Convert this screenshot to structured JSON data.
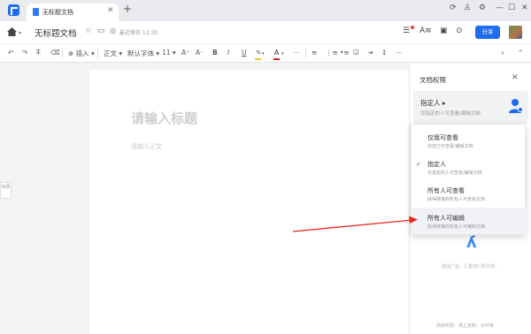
{
  "tab": {
    "title": "无标题文档"
  },
  "header": {
    "doc_title": "无标题文档",
    "save_status": "最近保存 12:30",
    "share_label": "分享"
  },
  "toolbar": {
    "insert_label": "插入",
    "style_label": "正文",
    "font_label": "默认字体",
    "font_size": "11",
    "bold": "B",
    "italic": "I",
    "underline": "U",
    "strike": "S",
    "highlight_color": "#f5c518",
    "font_color": "#e02020"
  },
  "editor": {
    "title_placeholder": "请输入标题",
    "body_placeholder": "请输入正文"
  },
  "outline_tab": {
    "label": "目录"
  },
  "panel": {
    "title": "文档权限",
    "current": {
      "name": "指定人",
      "desc": "仅指定的人可查看/编辑文档"
    },
    "note": "邀请广益，汇集他们的灵感。",
    "footer": "高级权限：禁止复制、水印等"
  },
  "dropdown": {
    "items": [
      {
        "name": "仅我可查看",
        "desc": "仅自己可查看/编辑文档",
        "checked": false,
        "highlighted": false
      },
      {
        "name": "指定人",
        "desc": "仅指定的人可查看/编辑文档",
        "checked": true,
        "highlighted": false
      },
      {
        "name": "所有人可查看",
        "desc": "获得链接的所有人可查看文档",
        "checked": false,
        "highlighted": false
      },
      {
        "name": "所有人可编辑",
        "desc": "获得链接的所有人可编辑文档",
        "checked": false,
        "highlighted": true
      }
    ]
  },
  "colors": {
    "accent": "#1f6bf2",
    "arrow": "#e8281e"
  }
}
